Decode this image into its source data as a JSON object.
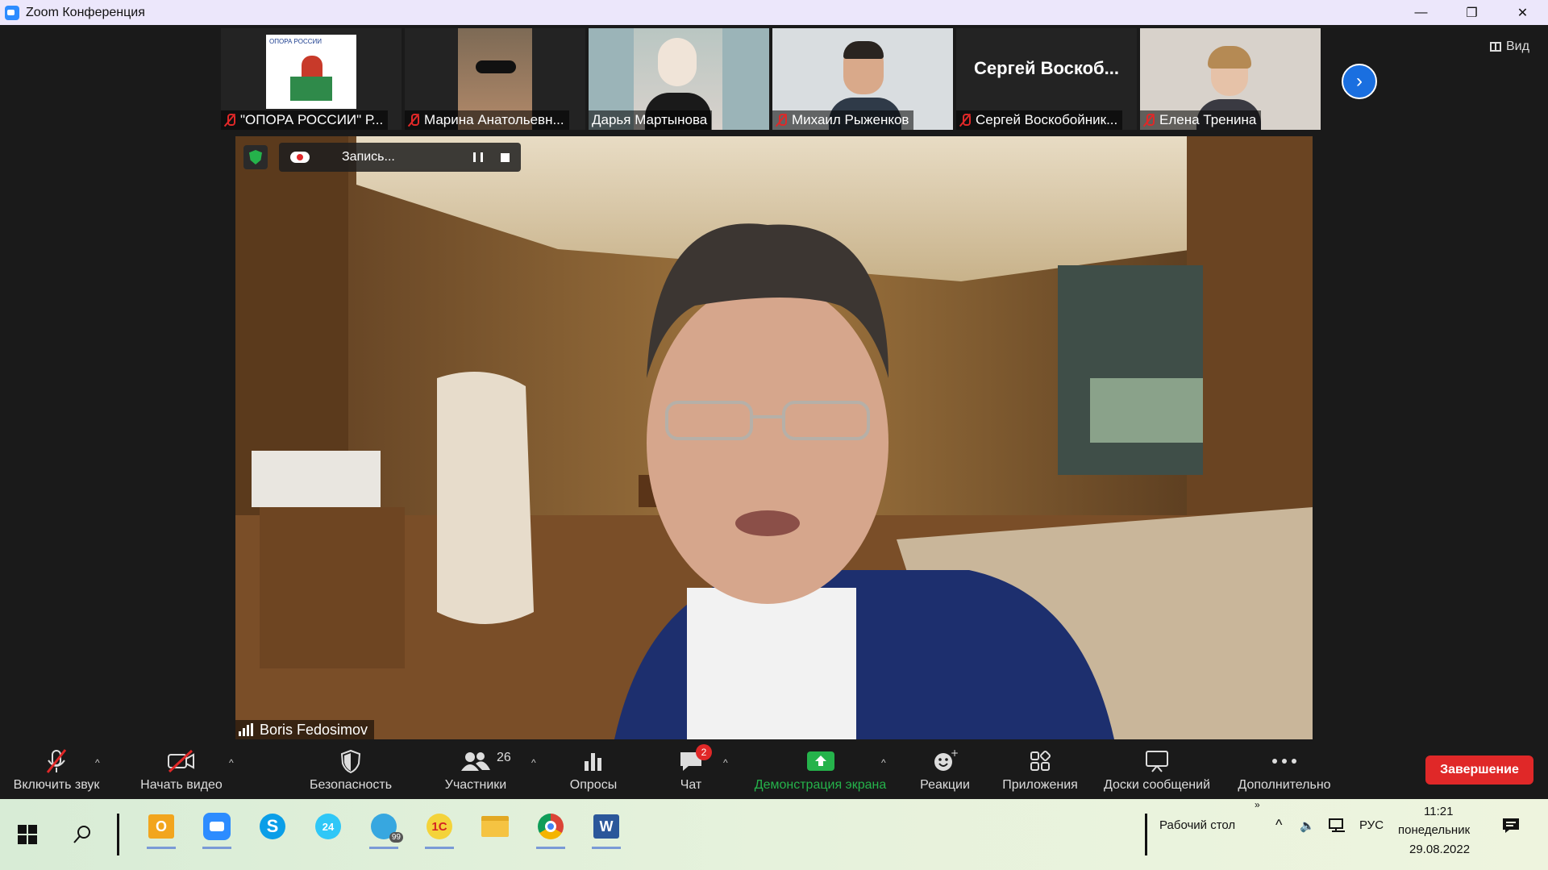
{
  "window": {
    "title": "Zoom Конференция",
    "minimize": "—",
    "restore": "❐",
    "close": "✕"
  },
  "view_button": {
    "label": "Вид"
  },
  "participants_strip": [
    {
      "name": "\"ОПОРА РОССИИ\" Р...",
      "muted": true
    },
    {
      "name": "Марина Анатольевн...",
      "muted": true
    },
    {
      "name": "Дарья Мартынова",
      "muted": false
    },
    {
      "name": "Михаил Рыженков",
      "muted": true
    },
    {
      "name": "Сергей Воскобойник...",
      "muted": true,
      "display_name": "Сергей Воскоб..."
    },
    {
      "name": "Елена Тренина",
      "muted": true
    }
  ],
  "thumb_logo_text": "ОПОРА РОССИИ",
  "recording": {
    "label": "Запись..."
  },
  "speaker": {
    "name": "Boris Fedosimov"
  },
  "toolbar": {
    "unmute": "Включить звук",
    "start_video": "Начать видео",
    "security": "Безопасность",
    "participants": "Участники",
    "participants_count": "26",
    "polls": "Опросы",
    "chat": "Чат",
    "chat_badge": "2",
    "share_screen": "Демонстрация экрана",
    "reactions": "Реакции",
    "apps": "Приложения",
    "whiteboards": "Доски сообщений",
    "more": "Дополнительно",
    "end": "Завершение"
  },
  "taskbar": {
    "desktop": "Рабочий стол",
    "language": "РУС",
    "time": "11:21",
    "weekday": "понедельник",
    "date": "29.08.2022",
    "chat_app_badge": "99"
  },
  "colors": {
    "accent": "#2d8cff",
    "end_red": "#e02828",
    "share_green": "#25b34b"
  }
}
